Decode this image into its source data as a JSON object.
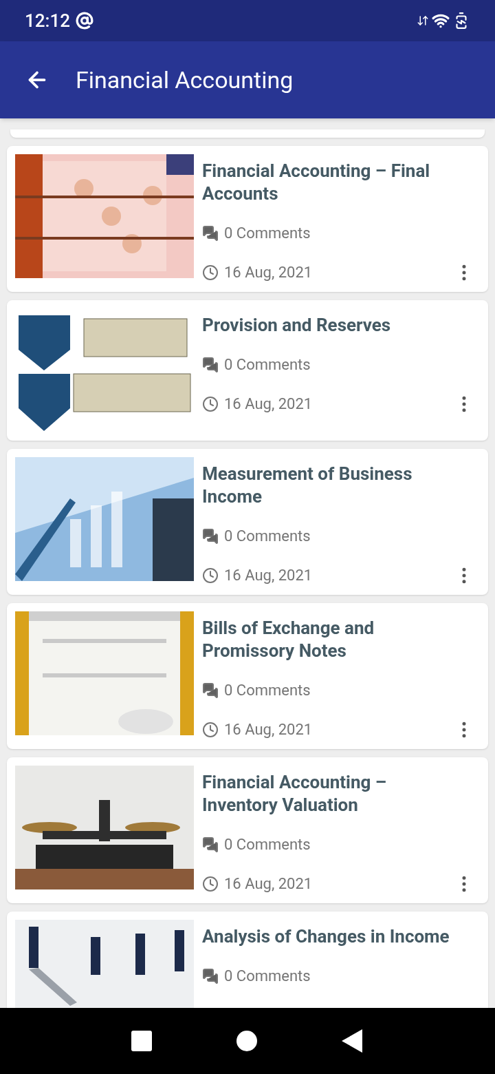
{
  "status_bar": {
    "time": "12:12"
  },
  "app_bar": {
    "title": "Financial Accounting"
  },
  "posts": [
    {
      "title": "Financial Accounting – Final Accounts",
      "comments": "0 Comments",
      "date": "16 Aug, 2021"
    },
    {
      "title": "Provision and Reserves",
      "comments": "0 Comments",
      "date": "16 Aug, 2021"
    },
    {
      "title": "Measurement of Business Income",
      "comments": "0 Comments",
      "date": "16 Aug, 2021"
    },
    {
      "title": "Bills of Exchange and Promissory Notes",
      "comments": "0 Comments",
      "date": "16 Aug, 2021"
    },
    {
      "title": "Financial Accounting – Inventory Valuation",
      "comments": "0 Comments",
      "date": "16 Aug, 2021"
    },
    {
      "title": "Analysis of Changes in Income",
      "comments": "0 Comments"
    }
  ]
}
